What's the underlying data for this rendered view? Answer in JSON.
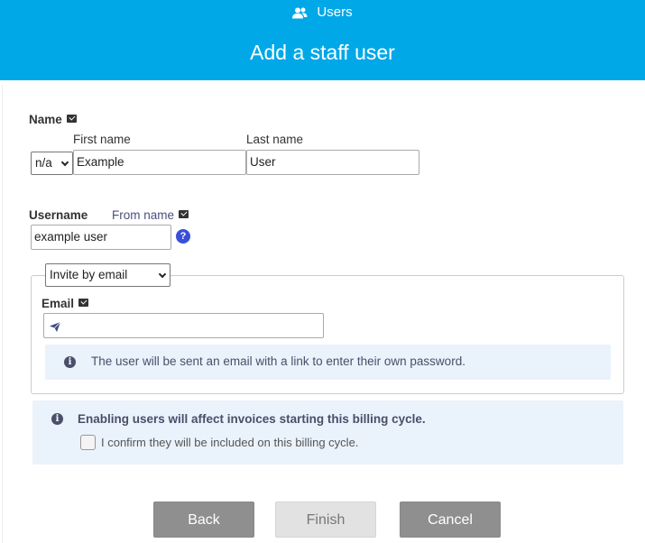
{
  "header": {
    "breadcrumb": "Users",
    "title": "Add a staff user"
  },
  "name_section": {
    "label": "Name",
    "title_select": "n/a",
    "first_name_label": "First name",
    "first_name_value": "Example",
    "last_name_label": "Last name",
    "last_name_value": "User"
  },
  "username_section": {
    "label": "Username",
    "from_name_label": "From name",
    "value": "example user",
    "help": "?"
  },
  "invite": {
    "method_select": "Invite by email",
    "email_label": "Email",
    "email_value": "",
    "info_text": "The user will be sent an email with a link to enter their own password."
  },
  "billing": {
    "warning": "Enabling users will affect invoices starting this billing cycle.",
    "confirm_label": "I confirm they will be included on this billing cycle.",
    "confirmed": false
  },
  "buttons": {
    "back": "Back",
    "finish": "Finish",
    "cancel": "Cancel"
  },
  "colors": {
    "header_bg": "#00a8e8",
    "info_bg": "#eaf2fb",
    "help_icon": "#3a4fd8"
  }
}
